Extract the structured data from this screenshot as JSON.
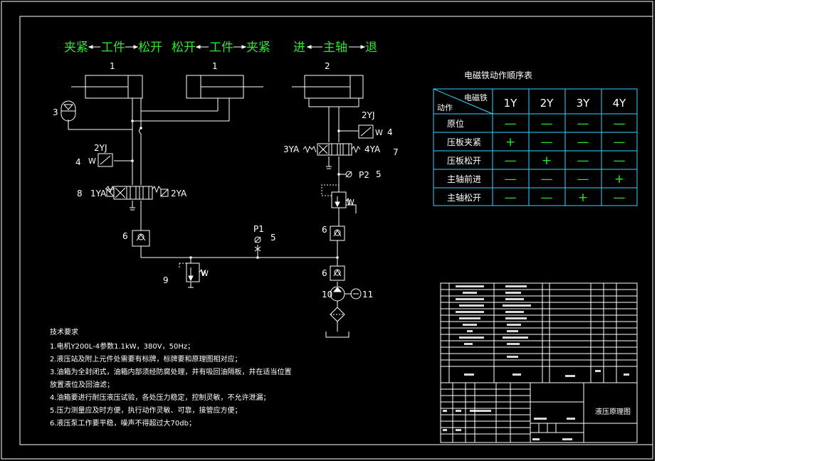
{
  "header_labels": [
    "夹紧",
    "工件",
    "松开",
    "松开",
    "工件",
    "夹紧",
    "进",
    "主轴",
    "退"
  ],
  "component_numbers": {
    "cyl_left_a": "1",
    "cyl_left_b": "1",
    "cyl_right": "2",
    "accumulator": "3",
    "pressure_switch_left": "4",
    "pressure_switch_right": "4",
    "gauge_p1": "5",
    "gauge_p2": "5",
    "check_valve_a": "6",
    "check_valve_b": "6",
    "check_valve_c": "6",
    "valve_right": "7",
    "valve_left": "8",
    "relief_valve": "9",
    "pump": "10",
    "motor": "11"
  },
  "component_labels": {
    "yj_left": "2YJ",
    "yj_right": "2YJ",
    "w1": "W",
    "w2": "W",
    "w3": "W",
    "w4": "W",
    "ya1": "1YA",
    "ya2": "2YA",
    "ya3": "3YA",
    "ya4": "4YA",
    "p1": "P1",
    "p2": "P2"
  },
  "sequence_table": {
    "title": "电磁铁动作顺序表",
    "corner_top": "电磁铁",
    "corner_bottom": "动作",
    "columns": [
      "1Y",
      "2Y",
      "3Y",
      "4Y"
    ],
    "rows": [
      {
        "action": "原位",
        "states": [
          "—",
          "—",
          "—",
          "—"
        ]
      },
      {
        "action": "压板夹紧",
        "states": [
          "+",
          "—",
          "—",
          "—"
        ]
      },
      {
        "action": "压板松开",
        "states": [
          "—",
          "+",
          "—",
          "—"
        ]
      },
      {
        "action": "主轴前进",
        "states": [
          "—",
          "—",
          "—",
          "+"
        ]
      },
      {
        "action": "主轴松开",
        "states": [
          "—",
          "—",
          "+",
          "—"
        ]
      }
    ]
  },
  "tech_requirements": {
    "title": "技术要求",
    "items": [
      "1.电机Y200L-4参数1.1kW，380V，50Hz；",
      "2.液压站及附上元件处需要有标牌，标牌要和原理图相对应；",
      "3.油箱为全封闭式，油箱内部须经防腐处理，并有吸回油隔板，并在适当位置",
      "放置液位及回油滤；",
      "4.油箱要进行耐压液压试验，各处压力稳定，控制灵敏，不允许泄漏；",
      "5.压力测量应及时方便，执行动作灵敏、可靠，接管应方便；",
      "6.液压泵工作要平稳，噪声不得超过大70db；"
    ]
  },
  "title_block": {
    "drawing_title": "液压原理图"
  },
  "colors": {
    "background": "#000000",
    "lines": "#ffffff",
    "header_text": "#2ee62e",
    "table_border": "#33d6ff",
    "plus_minus": "#2ee62e",
    "title_text": "#ffffff"
  }
}
